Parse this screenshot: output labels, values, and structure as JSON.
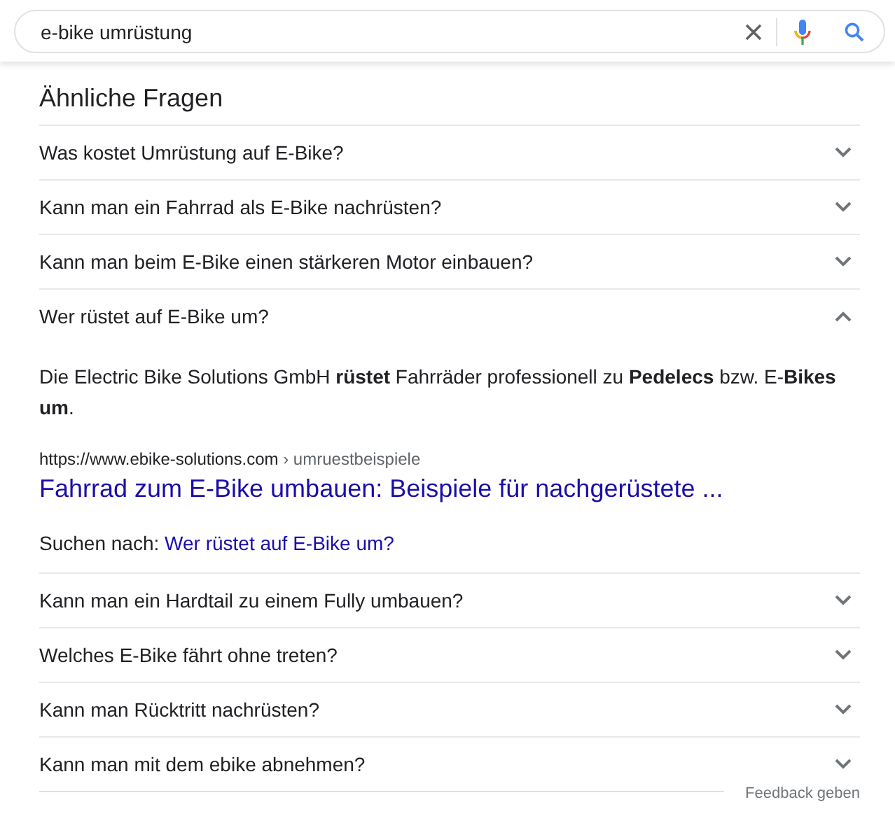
{
  "search": {
    "value": "e-bike umrüstung"
  },
  "heading": "Ähnliche Fragen",
  "questions": [
    {
      "text": "Was kostet Umrüstung auf E-Bike?",
      "expanded": false
    },
    {
      "text": "Kann man ein Fahrrad als E-Bike nachrüsten?",
      "expanded": false
    },
    {
      "text": "Kann man beim E-Bike einen stärkeren Motor einbauen?",
      "expanded": false
    },
    {
      "text": "Wer rüstet auf E-Bike um?",
      "expanded": true,
      "answer": {
        "text": "Die Electric Bike Solutions GmbH **rüstet** Fahrräder professionell zu **Pedelecs** bzw. E-**Bikes um**.",
        "url": "https://www.ebike-solutions.com",
        "path": "› umruestbeispiele",
        "title": "Fahrrad zum E-Bike umbauen: Beispiele für nachgerüstete ...",
        "search_label": "Suchen nach:",
        "search_link": "Wer rüstet auf E-Bike um?"
      }
    },
    {
      "text": "Kann man ein Hardtail zu einem Fully umbauen?",
      "expanded": false
    },
    {
      "text": "Welches E-Bike fährt ohne treten?",
      "expanded": false
    },
    {
      "text": "Kann man Rücktritt nachrüsten?",
      "expanded": false
    },
    {
      "text": "Kann man mit dem ebike abnehmen?",
      "expanded": false
    }
  ],
  "feedback": "Feedback geben"
}
